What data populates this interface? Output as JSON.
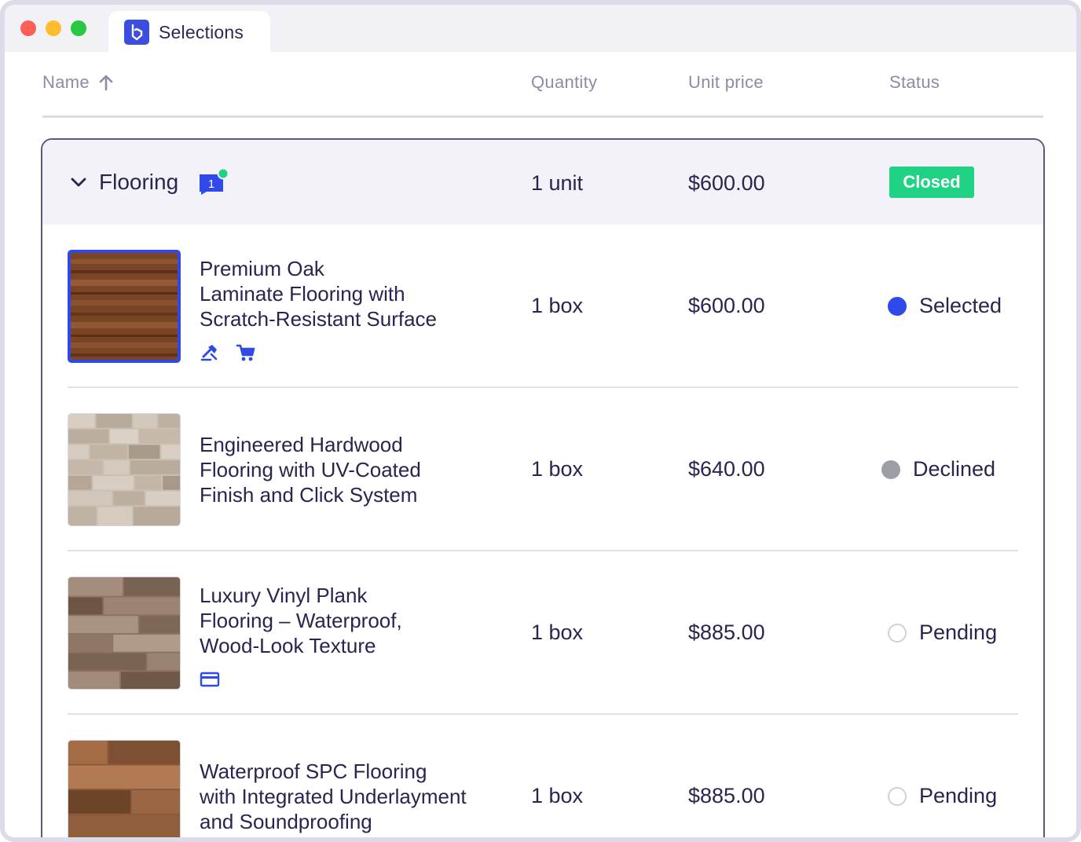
{
  "window": {
    "tab_title": "Selections",
    "logo_icon": "selections-logo-icon"
  },
  "table": {
    "headers": {
      "name": "Name",
      "quantity": "Quantity",
      "unit_price": "Unit price",
      "status": "Status"
    },
    "sort_icon": "arrow-up-icon"
  },
  "group": {
    "title": "Flooring",
    "comment_count": "1",
    "quantity": "1 unit",
    "unit_price": "$600.00",
    "status": "Closed",
    "status_color": "#20d384"
  },
  "items": [
    {
      "name_lines": [
        "Premium Oak",
        "Laminate Flooring with",
        "Scratch-Resistant Surface"
      ],
      "quantity": "1 box",
      "unit_price": "$600.00",
      "status": "Selected",
      "icons": [
        "gavel-icon",
        "cart-icon"
      ]
    },
    {
      "name_lines": [
        "Engineered Hardwood",
        "Flooring with UV-Coated",
        "Finish and Click System"
      ],
      "quantity": "1 box",
      "unit_price": "$640.00",
      "status": "Declined",
      "icons": []
    },
    {
      "name_lines": [
        "Luxury Vinyl Plank",
        "Flooring – Waterproof,",
        "Wood-Look Texture"
      ],
      "quantity": "1 box",
      "unit_price": "$885.00",
      "status": "Pending",
      "icons": [
        "credit-card-icon"
      ]
    },
    {
      "name_lines": [
        "Waterproof SPC Flooring",
        "with Integrated Underlayment",
        "and Soundproofing"
      ],
      "quantity": "1 box",
      "unit_price": "$885.00",
      "status": "Pending",
      "icons": []
    }
  ],
  "colors": {
    "accent": "#3048e5",
    "text": "#26264f",
    "header_text": "#8b8ca6",
    "selected": "#2f4ae8",
    "declined": "#9e9ea6"
  }
}
